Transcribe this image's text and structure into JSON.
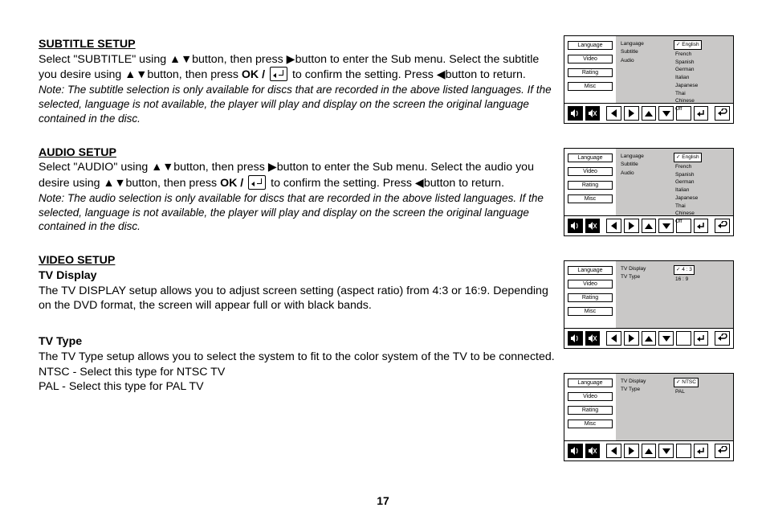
{
  "page_number": "17",
  "sections": {
    "subtitle": {
      "heading": "SUBTITLE SETUP",
      "body_a": "Select \"SUBTITLE\" using ",
      "body_b": "button, then press ",
      "body_c": "button to enter the Sub menu. Select the subtitle you desire using ",
      "body_d": "button, then press ",
      "ok": "OK / ",
      "body_e": " to confirm the setting. Press ",
      "body_f": "button to return.",
      "note": "Note: The subtitle selection is only available for discs that are recorded in the above listed languages. If the selected, language is not available, the player will play and display on the screen the original language contained in the disc."
    },
    "audio": {
      "heading": "AUDIO SETUP",
      "body_a": "Select \"AUDIO\" using ",
      "body_b": "button, then press ",
      "body_c": "button to enter the Sub menu. Select the audio you desire using ",
      "body_d": "button, then press  ",
      "ok": "OK / ",
      "body_e": "  to confirm the setting. Press ",
      "body_f": "button to return.",
      "note": "Note: The audio selection is only available for discs that are recorded in the above listed languages. If the selected, language is not available, the player will play and display on the screen the original language contained in the disc."
    },
    "video": {
      "heading": "VIDEO SETUP",
      "tv_display_head": "TV Display",
      "tv_display_body": "The TV DISPLAY setup allows you to adjust  screen setting (aspect ratio) from 4:3 or 16:9.  Depending on the DVD format, the screen will appear full or with black bands.",
      "tv_type_head": "TV Type",
      "tv_type_l1": "The TV Type setup allows you to select the system to fit to the color system of the TV to be connected.",
      "tv_type_l2": "NTSC - Select this type for NTSC TV",
      "tv_type_l3": "PAL - Select this type for PAL TV"
    }
  },
  "osd_menu_items": [
    "Language",
    "Video",
    "Rating",
    "Misc"
  ],
  "osd1": {
    "mid": [
      "Language",
      "Subtitle",
      "Audio"
    ],
    "right": [
      "English",
      "French",
      "Spanish",
      "German",
      "Italian",
      "Japanese",
      "Thai",
      "Chinese",
      "Off"
    ],
    "sel_index": 0
  },
  "osd2": {
    "mid": [
      "Language",
      "Subtitle",
      "Audio"
    ],
    "right": [
      "English",
      "French",
      "Spanish",
      "German",
      "Italian",
      "Japanese",
      "Thai",
      "Chinese",
      "Off"
    ],
    "sel_index": 0
  },
  "osd3": {
    "mid": [
      "TV Display",
      "TV Type"
    ],
    "right": [
      "4 : 3",
      "16 : 9"
    ],
    "sel_index": 0
  },
  "osd4": {
    "mid": [
      "TV Display",
      "TV Type"
    ],
    "right": [
      "NTSC",
      "PAL"
    ],
    "sel_index": 0
  }
}
